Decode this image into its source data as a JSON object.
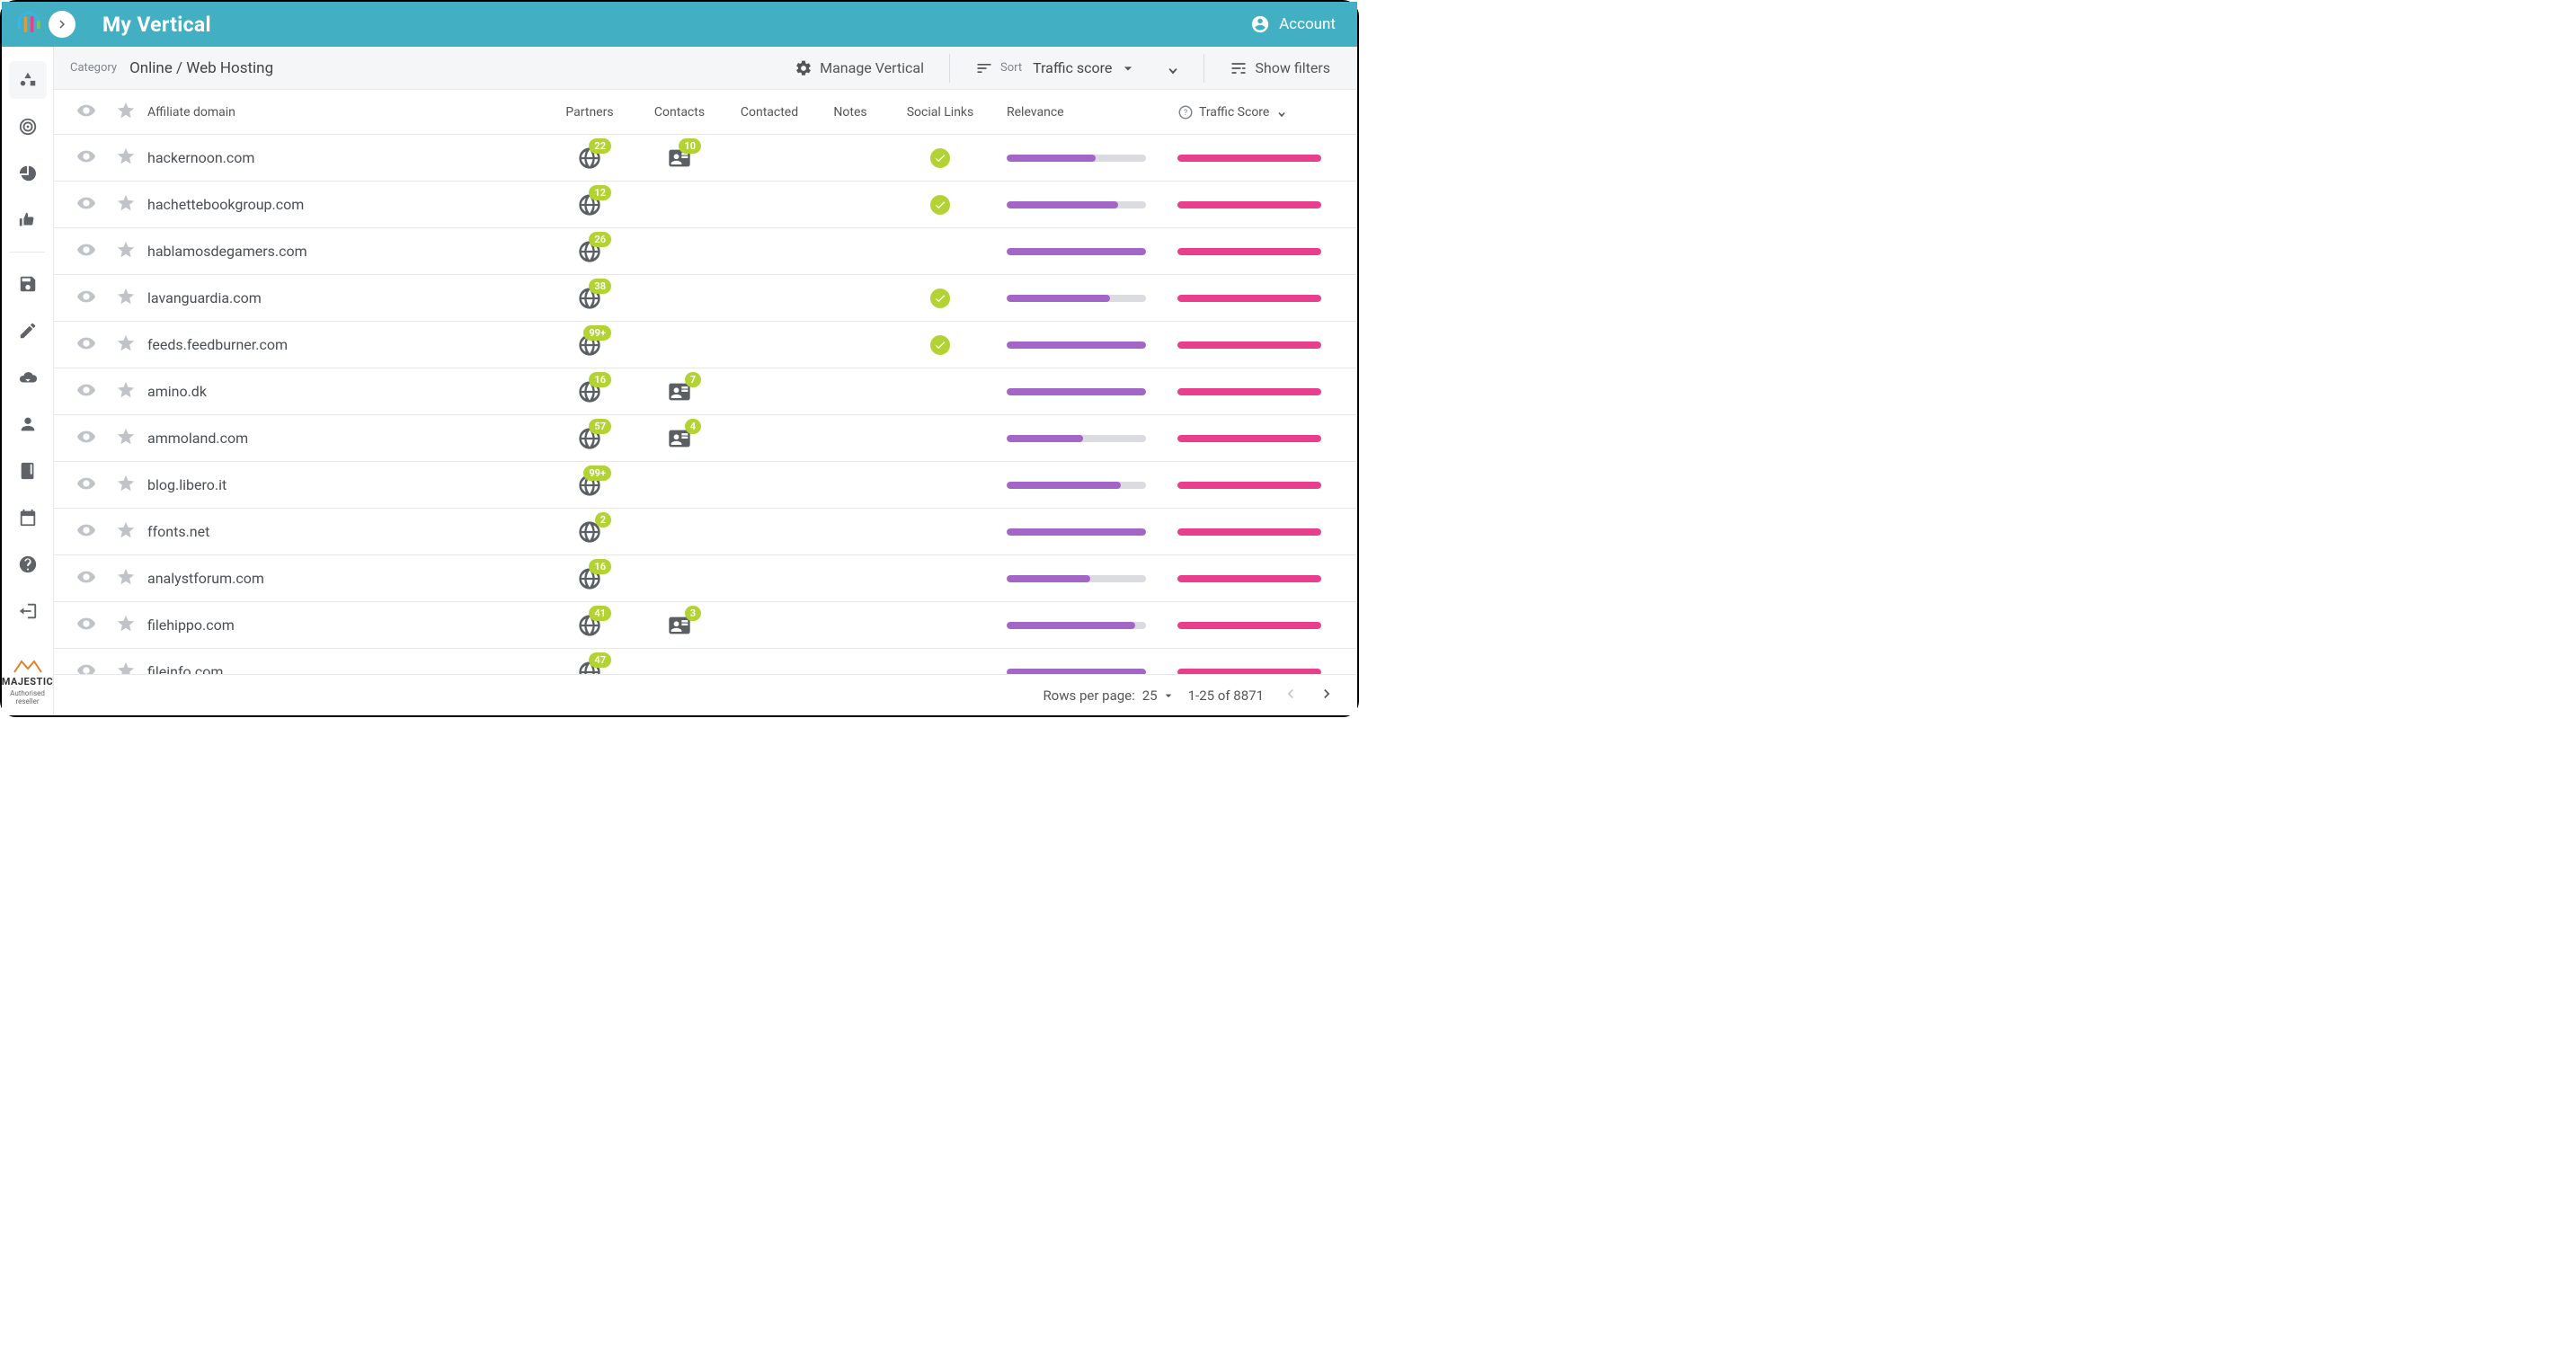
{
  "header": {
    "title": "My Vertical",
    "account_label": "Account"
  },
  "sidebar": {
    "items": [
      {
        "name": "shapes-icon",
        "active": true
      },
      {
        "name": "target-icon"
      },
      {
        "name": "pie-icon"
      },
      {
        "name": "thumbs-icon"
      },
      {
        "name": "save-icon"
      },
      {
        "name": "pencil-icon"
      },
      {
        "name": "cloud-download-icon"
      },
      {
        "name": "person-icon"
      },
      {
        "name": "book-icon"
      },
      {
        "name": "calendar-icon"
      },
      {
        "name": "help-icon"
      },
      {
        "name": "logout-icon"
      }
    ],
    "footer_brand": "MAJESTIC",
    "footer_sub": "Authorised reseller"
  },
  "toolbar": {
    "category_label": "Category",
    "category_value": "Online / Web Hosting",
    "manage_label": "Manage Vertical",
    "sort_label": "Sort",
    "sort_value": "Traffic score",
    "filters_label": "Show filters"
  },
  "columns": {
    "affiliate": "Affiliate domain",
    "partners": "Partners",
    "contacts": "Contacts",
    "contacted": "Contacted",
    "notes": "Notes",
    "social": "Social Links",
    "relevance": "Relevance",
    "traffic": "Traffic Score"
  },
  "rows": [
    {
      "domain": "hackernoon.com",
      "partners": "22",
      "contacts": "10",
      "social": true,
      "rel": 64,
      "traf": 100
    },
    {
      "domain": "hachettebookgroup.com",
      "partners": "12",
      "contacts": null,
      "social": true,
      "rel": 80,
      "traf": 100
    },
    {
      "domain": "hablamosdegamers.com",
      "partners": "26",
      "contacts": null,
      "social": false,
      "rel": 100,
      "traf": 100
    },
    {
      "domain": "lavanguardia.com",
      "partners": "38",
      "contacts": null,
      "social": true,
      "rel": 74,
      "traf": 100
    },
    {
      "domain": "feeds.feedburner.com",
      "partners": "99+",
      "contacts": null,
      "social": true,
      "rel": 100,
      "traf": 100
    },
    {
      "domain": "amino.dk",
      "partners": "16",
      "contacts": "7",
      "social": false,
      "rel": 100,
      "traf": 100
    },
    {
      "domain": "ammoland.com",
      "partners": "57",
      "contacts": "4",
      "social": false,
      "rel": 55,
      "traf": 100
    },
    {
      "domain": "blog.libero.it",
      "partners": "99+",
      "contacts": null,
      "social": false,
      "rel": 82,
      "traf": 100
    },
    {
      "domain": "ffonts.net",
      "partners": "2",
      "contacts": null,
      "social": false,
      "rel": 100,
      "traf": 100
    },
    {
      "domain": "analystforum.com",
      "partners": "16",
      "contacts": null,
      "social": false,
      "rel": 60,
      "traf": 100
    },
    {
      "domain": "filehippo.com",
      "partners": "41",
      "contacts": "3",
      "social": false,
      "rel": 92,
      "traf": 100
    },
    {
      "domain": "fileinfo.com",
      "partners": "47",
      "contacts": null,
      "social": false,
      "rel": 100,
      "traf": 100
    }
  ],
  "footer": {
    "rpp_label": "Rows per page:",
    "rpp_value": "25",
    "range": "1-25 of 8871"
  }
}
